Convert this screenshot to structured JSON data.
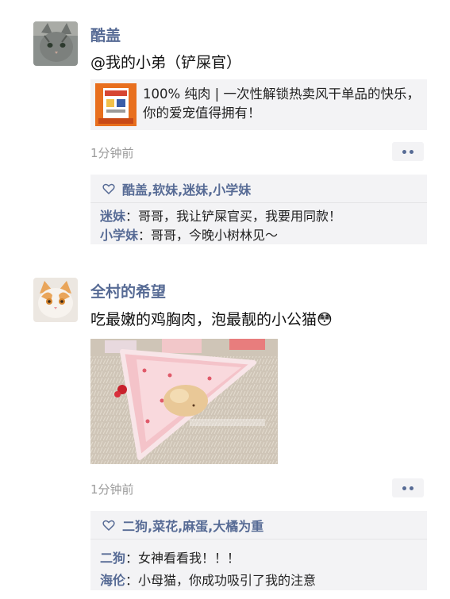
{
  "posts": [
    {
      "author": "酷盖",
      "text": "@我的小弟（铲屎官）",
      "link": {
        "title": "100% 纯肉 | 一次性解锁热卖风干单品的快乐，你的爱宠值得拥有！"
      },
      "time": "1分钟前",
      "likes": "酷盖,软妹,迷妹,小学妹",
      "comments": [
        {
          "name": "迷妹",
          "sep": "：",
          "text": "哥哥，我让铲屎官买，我要用同款！"
        },
        {
          "name": "小学妹",
          "sep": "：",
          "text": "哥哥，今晚小树林见～"
        }
      ]
    },
    {
      "author": "全村的希望",
      "text": "吃最嫩的鸡胸肉，泡最靓的小公猫",
      "emoji": "😳",
      "time": "1分钟前",
      "likes": "二狗,菜花,麻蛋,大橘为重",
      "comments": [
        {
          "name": "二狗",
          "sep": "：",
          "text": "女神看看我！！！"
        },
        {
          "name": "海伦",
          "sep": "：",
          "text": "小母猫，你成功吸引了我的注意"
        }
      ]
    }
  ],
  "colors": {
    "name_blue": "#576b95",
    "panel_gray": "#f3f3f5",
    "time_gray": "#9b9b9b"
  },
  "icons": {
    "like": "heart-outline-icon",
    "more": "more-dots-icon"
  }
}
